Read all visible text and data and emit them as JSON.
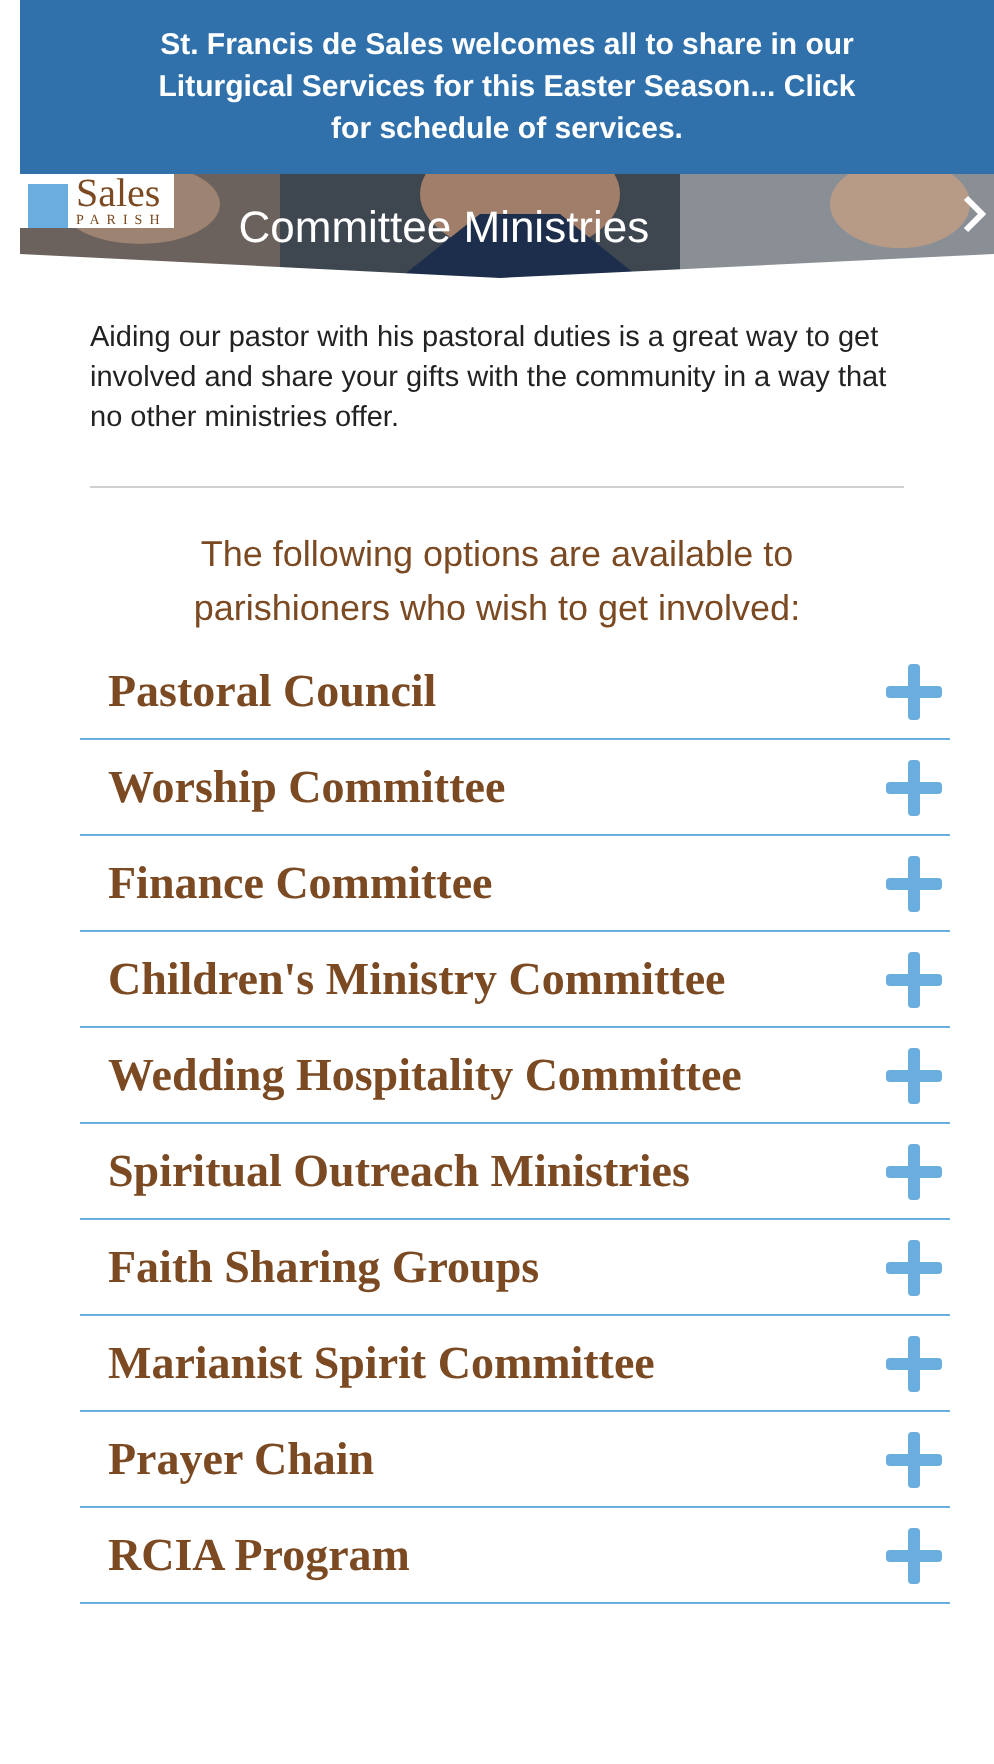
{
  "banner": {
    "text": "St. Francis de Sales welcomes all to share in our Liturgical Services for this Easter Season... Click for schedule of services."
  },
  "logo": {
    "name": "Sales",
    "subtitle": "PARISH"
  },
  "hero": {
    "title": "Committee Ministries"
  },
  "intro": "Aiding our pastor with his pastoral duties is a great way to get involved and share your gifts with the community in a way that no other ministries offer.",
  "options_heading": "The following options are available to parishioners who wish to get involved:",
  "accordion": [
    {
      "label": "Pastoral Council",
      "expanded": false
    },
    {
      "label": "Worship Committee",
      "expanded": false
    },
    {
      "label": "Finance Committee",
      "expanded": false
    },
    {
      "label": "Children's Ministry Committee",
      "expanded": false
    },
    {
      "label": "Wedding Hospitality Committee",
      "expanded": false
    },
    {
      "label": "Spiritual Outreach Ministries",
      "expanded": false
    },
    {
      "label": "Faith Sharing Groups",
      "expanded": false
    },
    {
      "label": "Marianist Spirit Committee",
      "expanded": false
    },
    {
      "label": "Prayer Chain",
      "expanded": false
    },
    {
      "label": "RCIA Program",
      "expanded": false
    }
  ]
}
